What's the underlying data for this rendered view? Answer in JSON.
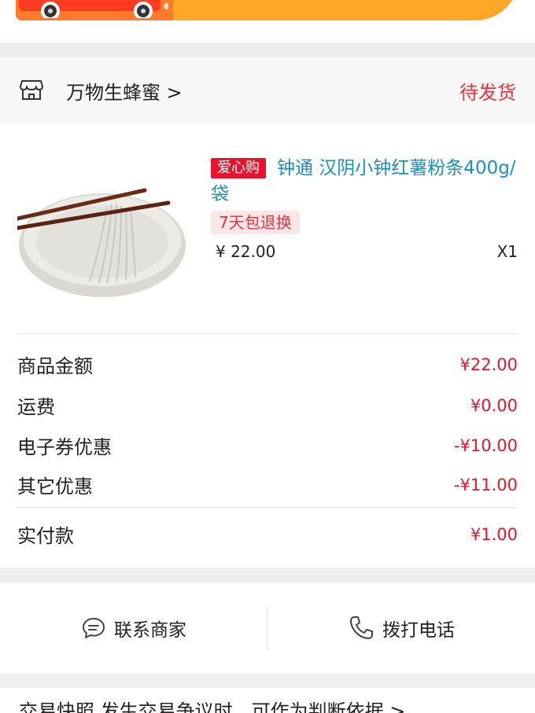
{
  "store": {
    "name": "万物生蜂蜜 >",
    "status": "待发货"
  },
  "product": {
    "tag": "爱心购",
    "title": "钟通 汉阴小钟红薯粉条400g/袋",
    "badge": "7天包退换",
    "price": "¥ 22.00",
    "qty": "X1"
  },
  "summary": [
    {
      "label": "商品金额",
      "value": "¥22.00"
    },
    {
      "label": "运费",
      "value": "¥0.00"
    },
    {
      "label": "电子券优惠",
      "value": "-¥10.00"
    },
    {
      "label": "其它优惠",
      "value": "-¥11.00"
    },
    {
      "label": "实付款",
      "value": "¥1.00"
    }
  ],
  "contact": {
    "chat_label": "联系商家",
    "call_label": "拨打电话"
  },
  "snapshot": {
    "text": "交易快照 发生交易争议时，可作为判断依据 >"
  },
  "colors": {
    "accent_red": "#e8142d",
    "link_blue": "#1c8fc0",
    "banner_orange": "#ffa726"
  },
  "icons": {
    "store": "store-icon",
    "chat": "chat-bubble-icon",
    "phone": "phone-icon",
    "truck": "delivery-truck-icon"
  }
}
